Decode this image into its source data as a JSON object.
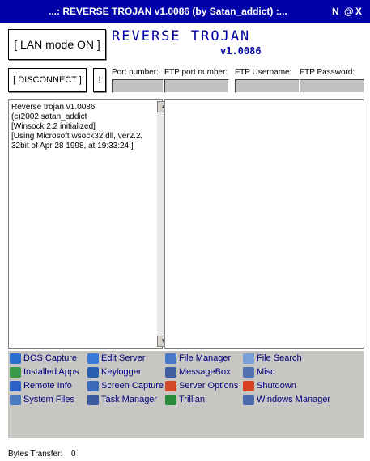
{
  "window": {
    "title": "...: REVERSE TROJAN v1.0086  (by Satan_addict) :...",
    "ctrl_n": "N",
    "ctrl_at": "@",
    "ctrl_x": "X"
  },
  "header": {
    "brand": "REVERSE TROJAN",
    "version": "v1.0086"
  },
  "buttons": {
    "lan_mode": "[ LAN mode ON ]",
    "disconnect": "[ DISCONNECT ]",
    "bang": "!"
  },
  "fields": {
    "port_label": "Port number:",
    "ftp_port_label": "FTP port number:",
    "ftp_user_label": "FTP Username:",
    "ftp_pass_label": "FTP Password:",
    "port_value": "",
    "ftp_port_value": "",
    "ftp_user_value": "",
    "ftp_pass_value": ""
  },
  "log": {
    "text": "Reverse trojan v1.0086\n(c)2002 satan_addict\n[Winsock 2.2 initialized]\n[Using Microsoft wsock32.dll, ver2.2, 32bit of Apr 28 1998, at 19:33:24.]"
  },
  "tools": [
    {
      "label": "DOS Capture",
      "icon": "globe-icon",
      "color": "#2a6fd0"
    },
    {
      "label": "Edit Server",
      "icon": "edit-server-icon",
      "color": "#3a7ad8"
    },
    {
      "label": "File Manager",
      "icon": "file-manager-icon",
      "color": "#4a78c8"
    },
    {
      "label": "File Search",
      "icon": "magnifier-icon",
      "color": "#7aa0d8"
    },
    {
      "label": "Installed Apps",
      "icon": "apps-icon",
      "color": "#3a9a4a"
    },
    {
      "label": "Keylogger",
      "icon": "keyboard-icon",
      "color": "#2a5fb0"
    },
    {
      "label": "MessageBox",
      "icon": "messagebox-icon",
      "color": "#4060a0"
    },
    {
      "label": "Misc",
      "icon": "misc-icon",
      "color": "#5070b0"
    },
    {
      "label": "Remote Info",
      "icon": "info-icon",
      "color": "#2a60c8"
    },
    {
      "label": "Screen Capture",
      "icon": "monitor-icon",
      "color": "#3a6ab8"
    },
    {
      "label": "Server Options",
      "icon": "server-options-icon",
      "color": "#d04a2a"
    },
    {
      "label": "Shutdown",
      "icon": "power-icon",
      "color": "#d84020"
    },
    {
      "label": "System Files",
      "icon": "system-files-icon",
      "color": "#4a7ac0"
    },
    {
      "label": "Task Manager",
      "icon": "task-manager-icon",
      "color": "#3a5aa0"
    },
    {
      "label": "Trillian",
      "icon": "trillian-icon",
      "color": "#2a8a3a"
    },
    {
      "label": "Windows Manager",
      "icon": "windows-manager-icon",
      "color": "#4a6ab0"
    }
  ],
  "status": {
    "label": "Bytes Transfer:",
    "value": "0"
  },
  "colors": {
    "titlebar": "#0000a8",
    "accent_text": "#0000a0",
    "link": "#00007f"
  }
}
